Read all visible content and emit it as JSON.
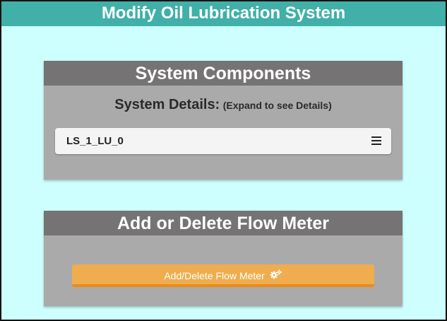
{
  "page": {
    "title": "Modify Oil Lubrication System"
  },
  "components_panel": {
    "header": "System Components",
    "details_label": "System Details:",
    "details_hint": "(Expand to see Details)",
    "systems": [
      {
        "label": "LS_1_LU_0",
        "icon": "hamburger-menu-icon"
      }
    ]
  },
  "flow_meter_panel": {
    "header": "Add or Delete Flow Meter",
    "button_label": "Add/Delete Flow Meter",
    "button_icon": "gears-icon"
  },
  "colors": {
    "background": "#ccfffe",
    "title_bar": "#40b0a8",
    "panel_header": "#757373",
    "panel_body": "#aaaaaa",
    "button": "#efad4f",
    "button_border": "#ec8b18"
  }
}
